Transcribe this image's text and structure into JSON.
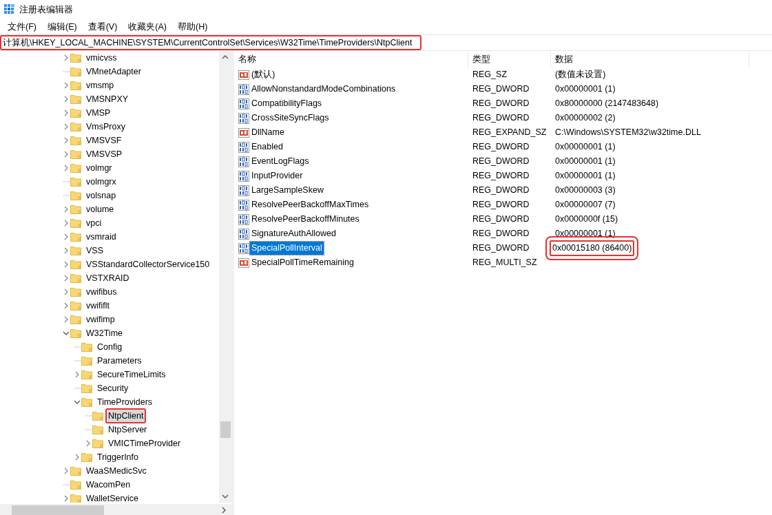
{
  "window": {
    "title": "注册表编辑器"
  },
  "menu": [
    {
      "label": "文件(F)"
    },
    {
      "label": "编辑(E)"
    },
    {
      "label": "查看(V)"
    },
    {
      "label": "收藏夹(A)"
    },
    {
      "label": "帮助(H)"
    }
  ],
  "address_bar": {
    "value": "计算机\\HKEY_LOCAL_MACHINE\\SYSTEM\\CurrentControlSet\\Services\\W32Time\\TimeProviders\\NtpClient",
    "annotated": true
  },
  "tree": [
    {
      "label": "vmicvss",
      "expandable": true,
      "expanded": false,
      "selected": false,
      "annotated": false
    },
    {
      "label": "VMnetAdapter",
      "expandable": false,
      "selected": false,
      "annotated": false
    },
    {
      "label": "vmsmp",
      "expandable": true,
      "expanded": false,
      "selected": false,
      "annotated": false
    },
    {
      "label": "VMSNPXY",
      "expandable": true,
      "expanded": false,
      "selected": false,
      "annotated": false
    },
    {
      "label": "VMSP",
      "expandable": true,
      "expanded": false,
      "selected": false,
      "annotated": false
    },
    {
      "label": "VmsProxy",
      "expandable": true,
      "expanded": false,
      "selected": false,
      "annotated": false
    },
    {
      "label": "VMSVSF",
      "expandable": true,
      "expanded": false,
      "selected": false,
      "annotated": false
    },
    {
      "label": "VMSVSP",
      "expandable": true,
      "expanded": false,
      "selected": false,
      "annotated": false
    },
    {
      "label": "volmgr",
      "expandable": true,
      "expanded": false,
      "selected": false,
      "annotated": false
    },
    {
      "label": "volmgrx",
      "expandable": false,
      "selected": false,
      "annotated": false
    },
    {
      "label": "volsnap",
      "expandable": false,
      "selected": false,
      "annotated": false
    },
    {
      "label": "volume",
      "expandable": true,
      "expanded": false,
      "selected": false,
      "annotated": false
    },
    {
      "label": "vpci",
      "expandable": true,
      "expanded": false,
      "selected": false,
      "annotated": false
    },
    {
      "label": "vsmraid",
      "expandable": true,
      "expanded": false,
      "selected": false,
      "annotated": false
    },
    {
      "label": "VSS",
      "expandable": true,
      "expanded": false,
      "selected": false,
      "annotated": false
    },
    {
      "label": "VSStandardCollectorService150",
      "expandable": true,
      "expanded": false,
      "selected": false,
      "annotated": false
    },
    {
      "label": "VSTXRAID",
      "expandable": true,
      "expanded": false,
      "selected": false,
      "annotated": false
    },
    {
      "label": "vwifibus",
      "expandable": true,
      "expanded": false,
      "selected": false,
      "annotated": false
    },
    {
      "label": "vwififlt",
      "expandable": true,
      "expanded": false,
      "selected": false,
      "annotated": false
    },
    {
      "label": "vwifimp",
      "expandable": true,
      "expanded": false,
      "selected": false,
      "annotated": false
    },
    {
      "label": "W32Time",
      "expandable": true,
      "expanded": true,
      "selected": false,
      "annotated": false,
      "children": [
        {
          "label": "Config",
          "expandable": false,
          "selected": false,
          "annotated": false
        },
        {
          "label": "Parameters",
          "expandable": false,
          "selected": false,
          "annotated": false
        },
        {
          "label": "SecureTimeLimits",
          "expandable": true,
          "expanded": false,
          "selected": false,
          "annotated": false
        },
        {
          "label": "Security",
          "expandable": false,
          "selected": false,
          "annotated": false
        },
        {
          "label": "TimeProviders",
          "expandable": true,
          "expanded": true,
          "selected": false,
          "annotated": false,
          "children": [
            {
              "label": "NtpClient",
              "expandable": false,
              "selected": true,
              "annotated": true
            },
            {
              "label": "NtpServer",
              "expandable": false,
              "selected": false,
              "annotated": false
            },
            {
              "label": "VMICTimeProvider",
              "expandable": true,
              "expanded": false,
              "selected": false,
              "annotated": false
            }
          ]
        },
        {
          "label": "TriggerInfo",
          "expandable": true,
          "expanded": false,
          "selected": false,
          "annotated": false
        }
      ]
    },
    {
      "label": "WaaSMedicSvc",
      "expandable": true,
      "expanded": false,
      "selected": false,
      "annotated": false
    },
    {
      "label": "WacomPen",
      "expandable": false,
      "selected": false,
      "annotated": false
    },
    {
      "label": "WalletService",
      "expandable": true,
      "expanded": false,
      "selected": false,
      "annotated": false
    }
  ],
  "table": {
    "columns": [
      "名称",
      "类型",
      "数据"
    ],
    "rows": [
      {
        "kind": "string",
        "name": "(默认)",
        "type": "REG_SZ",
        "data": "(数值未设置)",
        "selected": false,
        "annotated": false
      },
      {
        "kind": "dword",
        "name": "AllowNonstandardModeCombinations",
        "type": "REG_DWORD",
        "data": "0x00000001 (1)",
        "selected": false,
        "annotated": false
      },
      {
        "kind": "dword",
        "name": "CompatibilityFlags",
        "type": "REG_DWORD",
        "data": "0x80000000 (2147483648)",
        "selected": false,
        "annotated": false
      },
      {
        "kind": "dword",
        "name": "CrossSiteSyncFlags",
        "type": "REG_DWORD",
        "data": "0x00000002 (2)",
        "selected": false,
        "annotated": false
      },
      {
        "kind": "string",
        "name": "DllName",
        "type": "REG_EXPAND_SZ",
        "data": "C:\\Windows\\SYSTEM32\\w32time.DLL",
        "selected": false,
        "annotated": false
      },
      {
        "kind": "dword",
        "name": "Enabled",
        "type": "REG_DWORD",
        "data": "0x00000001 (1)",
        "selected": false,
        "annotated": false
      },
      {
        "kind": "dword",
        "name": "EventLogFlags",
        "type": "REG_DWORD",
        "data": "0x00000001 (1)",
        "selected": false,
        "annotated": false
      },
      {
        "kind": "dword",
        "name": "InputProvider",
        "type": "REG_DWORD",
        "data": "0x00000001 (1)",
        "selected": false,
        "annotated": false
      },
      {
        "kind": "dword",
        "name": "LargeSampleSkew",
        "type": "REG_DWORD",
        "data": "0x00000003 (3)",
        "selected": false,
        "annotated": false
      },
      {
        "kind": "dword",
        "name": "ResolvePeerBackoffMaxTimes",
        "type": "REG_DWORD",
        "data": "0x00000007 (7)",
        "selected": false,
        "annotated": false
      },
      {
        "kind": "dword",
        "name": "ResolvePeerBackoffMinutes",
        "type": "REG_DWORD",
        "data": "0x0000000f (15)",
        "selected": false,
        "annotated": false
      },
      {
        "kind": "dword",
        "name": "SignatureAuthAllowed",
        "type": "REG_DWORD",
        "data": "0x00000001 (1)",
        "selected": false,
        "annotated": false
      },
      {
        "kind": "dword",
        "name": "SpecialPollInterval",
        "type": "REG_DWORD",
        "data": "0x00015180 (86400)",
        "selected": true,
        "annotated": true
      },
      {
        "kind": "string",
        "name": "SpecialPollTimeRemaining",
        "type": "REG_MULTI_SZ",
        "selected": false,
        "annotated": false
      }
    ]
  }
}
